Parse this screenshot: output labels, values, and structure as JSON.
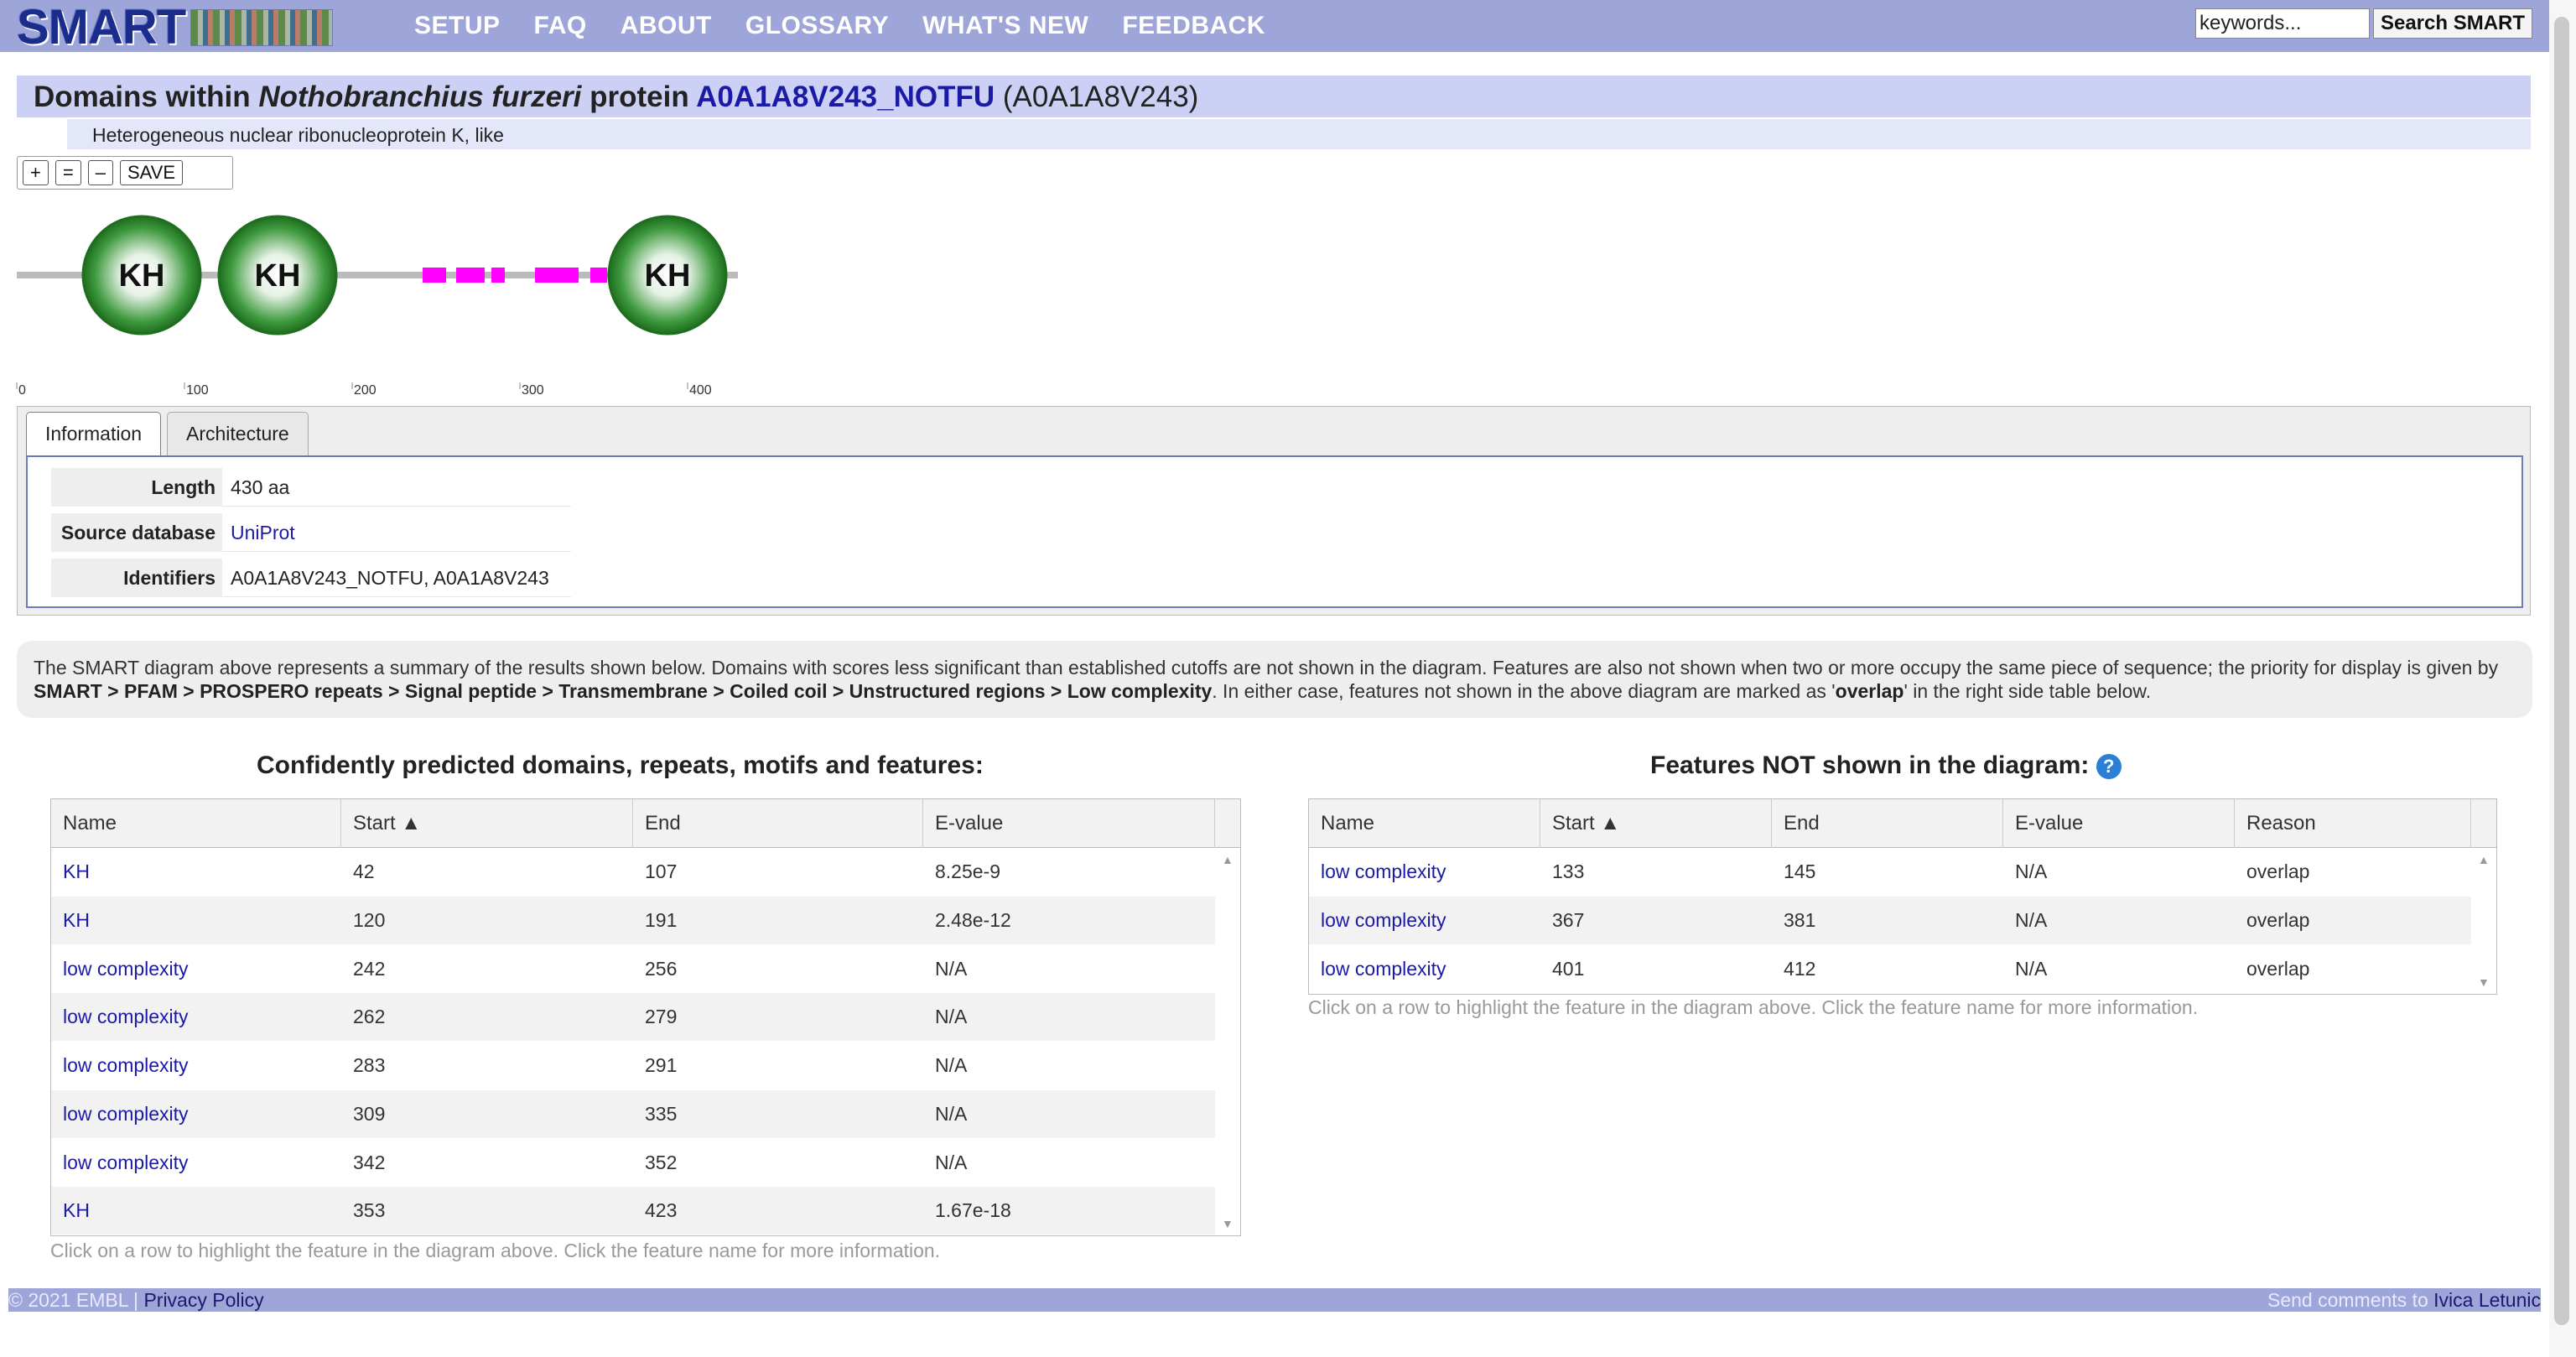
{
  "header": {
    "logo_text": "SMART",
    "nav": [
      "SETUP",
      "FAQ",
      "ABOUT",
      "GLOSSARY",
      "WHAT'S NEW",
      "FEEDBACK"
    ],
    "search": {
      "value": "keywords...",
      "button": "Search SMART"
    }
  },
  "title": {
    "prefix": "Domains within ",
    "species": "Nothobranchius furzeri",
    "middle": " protein ",
    "protein_id": "A0A1A8V243_NOTFU",
    "accession": " (A0A1A8V243)",
    "subtitle": "Heterogeneous nuclear ribonucleoprotein K, like"
  },
  "zoom": {
    "plus": "+",
    "equal": "=",
    "minus": "–",
    "save": "SAVE"
  },
  "diagram": {
    "length": 430,
    "ticks": [
      "0",
      "100",
      "200",
      "300",
      "400"
    ],
    "tick_values": [
      0,
      100,
      200,
      300,
      400
    ],
    "domains": [
      {
        "name": "KH",
        "start": 42,
        "end": 107
      },
      {
        "name": "KH",
        "start": 120,
        "end": 191
      },
      {
        "name": "KH",
        "start": 353,
        "end": 423
      }
    ],
    "low_complexity": [
      {
        "start": 242,
        "end": 256
      },
      {
        "start": 262,
        "end": 279
      },
      {
        "start": 283,
        "end": 291
      },
      {
        "start": 309,
        "end": 335
      },
      {
        "start": 342,
        "end": 352
      }
    ],
    "colors": {
      "domain": "#2e8b2e",
      "low_complexity": "#ff00ff",
      "line": "#bbbbbb"
    }
  },
  "tabs": [
    "Information",
    "Architecture"
  ],
  "info": [
    {
      "label": "Length",
      "value": "430 aa"
    },
    {
      "label": "Source database",
      "value": "UniProt"
    },
    {
      "label": "Identifiers",
      "value": "A0A1A8V243_NOTFU, A0A1A8V243"
    }
  ],
  "notice": {
    "part1": "The SMART diagram above represents a summary of the results shown below. Domains with scores less significant than established cutoffs are not shown in the diagram. Features are also not shown when two or more occupy the same piece of sequence; the priority for display is given by ",
    "priority": "SMART > PFAM > PROSPERO repeats > Signal peptide > Transmembrane > Coiled coil > Unstructured regions > Low complexity",
    "part2": ". In either case, features not shown in the above diagram are marked as '",
    "overlap": "overlap",
    "part3": "' in the right side table below."
  },
  "left_table": {
    "heading": "Confidently predicted domains, repeats, motifs and features:",
    "columns": [
      "Name",
      "Start ▲",
      "End",
      "E-value"
    ],
    "rows": [
      {
        "name": "KH",
        "start": "42",
        "end": "107",
        "evalue": "8.25e-9"
      },
      {
        "name": "KH",
        "start": "120",
        "end": "191",
        "evalue": "2.48e-12"
      },
      {
        "name": "low complexity",
        "start": "242",
        "end": "256",
        "evalue": "N/A"
      },
      {
        "name": "low complexity",
        "start": "262",
        "end": "279",
        "evalue": "N/A"
      },
      {
        "name": "low complexity",
        "start": "283",
        "end": "291",
        "evalue": "N/A"
      },
      {
        "name": "low complexity",
        "start": "309",
        "end": "335",
        "evalue": "N/A"
      },
      {
        "name": "low complexity",
        "start": "342",
        "end": "352",
        "evalue": "N/A"
      },
      {
        "name": "KH",
        "start": "353",
        "end": "423",
        "evalue": "1.67e-18"
      }
    ],
    "caption": "Click on a row to highlight the feature in the diagram above. Click the feature name for more information."
  },
  "right_table": {
    "heading": "Features NOT shown in the diagram:",
    "columns": [
      "Name",
      "Start ▲",
      "End",
      "E-value",
      "Reason"
    ],
    "rows": [
      {
        "name": "low complexity",
        "start": "133",
        "end": "145",
        "evalue": "N/A",
        "reason": "overlap"
      },
      {
        "name": "low complexity",
        "start": "367",
        "end": "381",
        "evalue": "N/A",
        "reason": "overlap"
      },
      {
        "name": "low complexity",
        "start": "401",
        "end": "412",
        "evalue": "N/A",
        "reason": "overlap"
      }
    ],
    "caption": "Click on a row to highlight the feature in the diagram above. Click the feature name for more information."
  },
  "footer": {
    "copyright": "© 2021 EMBL",
    "separator": " | ",
    "privacy": "Privacy Policy",
    "comments": "Send comments to ",
    "author": "Ivica Letunic"
  }
}
